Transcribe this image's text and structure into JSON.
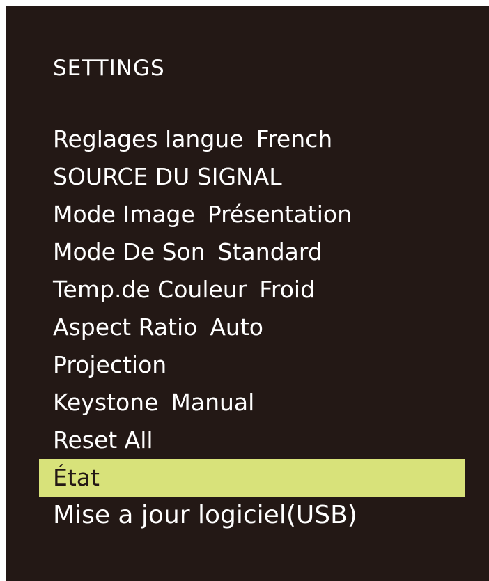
{
  "osd": {
    "title": "SETTINGS",
    "highlight_color": "#d8e27a",
    "background_color": "#231815",
    "items": [
      {
        "label": "Reglages langue",
        "value": "French"
      },
      {
        "label": "SOURCE DU SIGNAL",
        "value": ""
      },
      {
        "label": "Mode Image",
        "value": "Présentation"
      },
      {
        "label": "Mode De Son",
        "value": "Standard"
      },
      {
        "label": "Temp.de Couleur",
        "value": "Froid"
      },
      {
        "label": "Aspect Ratio",
        "value": "Auto"
      },
      {
        "label": "Projection",
        "value": ""
      },
      {
        "label": "Keystone",
        "value": "Manual"
      },
      {
        "label": "Reset All",
        "value": ""
      },
      {
        "label": "État",
        "value": "",
        "selected": true
      },
      {
        "label": "Mise a jour logiciel(USB)",
        "value": ""
      }
    ]
  }
}
